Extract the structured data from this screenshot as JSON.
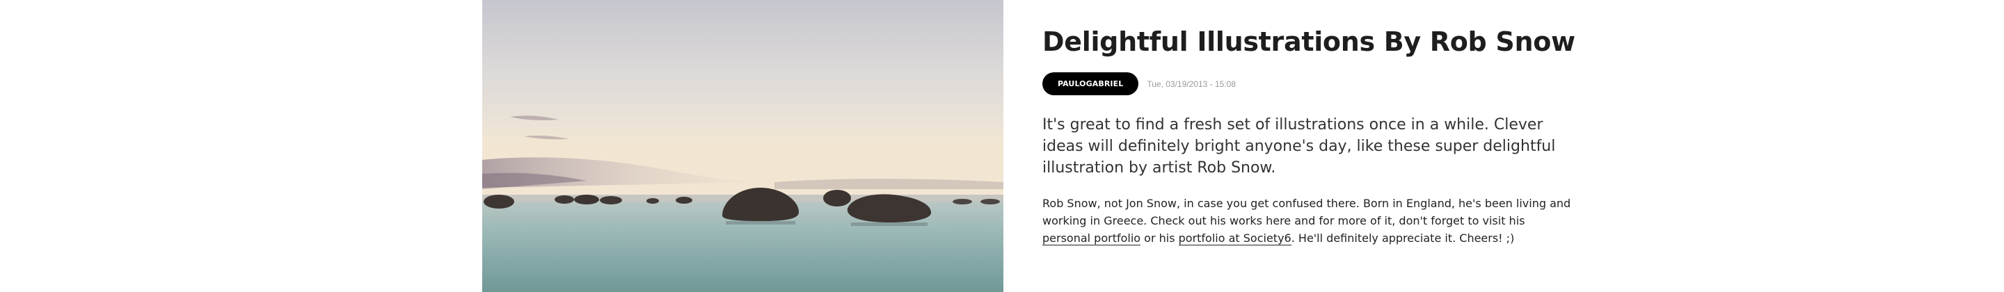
{
  "article": {
    "title": "Delightful Illustrations By Rob Snow",
    "author": "PAULOGABRIEL",
    "date": "Tue, 03/19/2013 - 15:08",
    "lead": "It's great to find a fresh set of illustrations once in a while. Clever ideas will definitely bright anyone's day, like these super delightful illustration by artist Rob Snow.",
    "body_part1": "Rob Snow, not Jon Snow, in case you get confused there. Born in England, he's been living and working in Greece. Check out his works here and for more of it, don't forget to visit his ",
    "link1": "personal portfolio",
    "body_part2": " or his ",
    "link2": "portfolio at Society6",
    "body_part3": ". He'll definitely appreciate it. Cheers! ;)"
  },
  "hero": {
    "subject": "seascape with rocks at dusk",
    "colors": {
      "sky_top": "#cfcfd4",
      "sky_mid": "#e6e2dd",
      "horizon": "#efe6da",
      "water": "#8fb1b1",
      "rock": "#3a3634"
    }
  }
}
